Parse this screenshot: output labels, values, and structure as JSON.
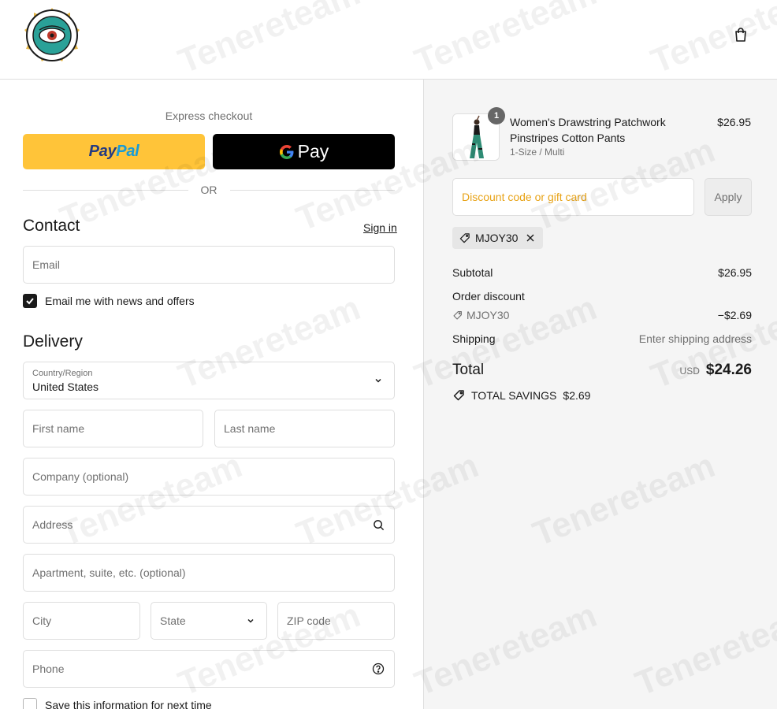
{
  "header": {
    "cart_icon": "bag-icon"
  },
  "express": {
    "title": "Express checkout",
    "paypal_a": "Pay",
    "paypal_b": "Pal",
    "gpay_label": "Pay",
    "or": "OR"
  },
  "contact": {
    "title": "Contact",
    "sign_in": "Sign in",
    "email_placeholder": "Email",
    "newsletter_label": "Email me with news and offers",
    "newsletter_checked": true
  },
  "delivery": {
    "title": "Delivery",
    "country_label": "Country/Region",
    "country_value": "United States",
    "first_name": "First name",
    "last_name": "Last name",
    "company": "Company (optional)",
    "address": "Address",
    "apartment": "Apartment, suite, etc. (optional)",
    "city": "City",
    "state": "State",
    "zip": "ZIP code",
    "phone": "Phone",
    "save_info": "Save this information for next time"
  },
  "summary": {
    "product": {
      "quantity": "1",
      "name": "Women's Drawstring Patchwork Pinstripes Cotton Pants",
      "variant": "1-Size / Multi",
      "price": "$26.95"
    },
    "discount_placeholder": "Discount code or gift card",
    "apply": "Apply",
    "applied_code": "MJOY30",
    "subtotal_label": "Subtotal",
    "subtotal_value": "$26.95",
    "order_discount_label": "Order discount",
    "discount_code": "MJOY30",
    "discount_value": "−$2.69",
    "shipping_label": "Shipping",
    "shipping_value": "Enter shipping address",
    "total_label": "Total",
    "currency": "USD",
    "total_value": "$24.26",
    "savings_label": "TOTAL SAVINGS",
    "savings_value": "$2.69"
  },
  "watermark": "Tenereteam",
  "colors": {
    "paypal_yellow": "#ffc439",
    "discount_placeholder": "#e8a317",
    "right_bg": "#f5f5f5"
  }
}
